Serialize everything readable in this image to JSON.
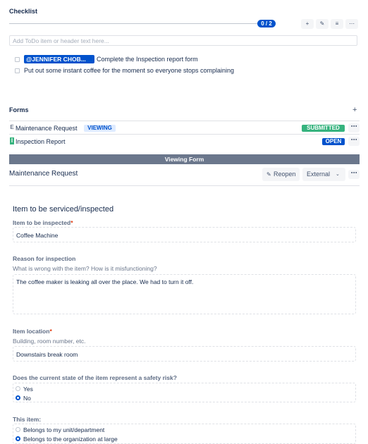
{
  "checklist": {
    "title": "Checklist",
    "progress_text": "0 / 2",
    "progress": 0,
    "tools": [
      "+",
      "✎",
      "≡",
      "⋯"
    ],
    "add_placeholder": "Add ToDo item or header text here...",
    "items": [
      {
        "mention": "@JENNIFER CHOB...",
        "text": "Complete the Inspection report form",
        "checked": false
      },
      {
        "text": "Put out some instant coffee for the moment so everyone stops complaining",
        "checked": false
      }
    ]
  },
  "forms": {
    "title": "Forms",
    "add_icon": "+",
    "list": [
      {
        "icon": "E",
        "name": "Maintenance Request",
        "tag": "VIEWING",
        "status": "SUBMITTED",
        "status_color": "#36b37e"
      },
      {
        "icon": "I",
        "name": "Inspection Report",
        "status": "OPEN",
        "status_color": "#0052cc"
      }
    ],
    "more_icon": "⋯"
  },
  "viewer": {
    "bar_label": "Viewing Form",
    "form_title": "Maintenance Request",
    "reopen_label": "Reopen",
    "external_label": "External",
    "more_icon": "⋯"
  },
  "form": {
    "heading": "Item to be serviced/inspected",
    "fields": {
      "item": {
        "label": "Item to be inspected",
        "required": "*",
        "value": "Coffee Machine"
      },
      "reason": {
        "label": "Reason for inspection",
        "desc": "What is wrong with the item? How is it misfunctioning?",
        "value": "The coffee maker is leaking all over the place. We had to turn it off."
      },
      "location": {
        "label": "Item location",
        "required": "*",
        "desc": "Building, room number, etc.",
        "value": "Downstairs break room"
      },
      "safety": {
        "label": "Does the current state of the item represent a safety risk?",
        "options": [
          "Yes",
          "No"
        ],
        "selected": "No"
      },
      "belongs": {
        "label": "This item:",
        "options": [
          "Belongs to my unit/department",
          "Belongs to the organization at large"
        ],
        "selected": "Belongs to the organization at large"
      }
    }
  }
}
